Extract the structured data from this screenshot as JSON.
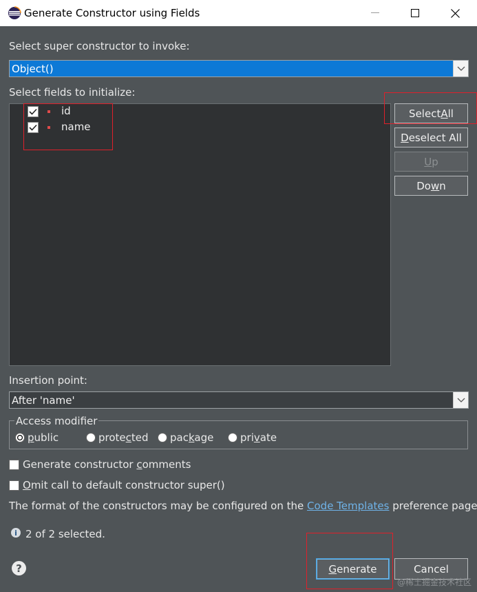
{
  "window": {
    "title": "Generate Constructor using Fields"
  },
  "super_constructor": {
    "label": "Select super constructor to invoke:",
    "selected": "Object()"
  },
  "fields": {
    "label": "Select fields to initialize:",
    "items": [
      {
        "name": "id",
        "checked": true
      },
      {
        "name": "name",
        "checked": true
      }
    ]
  },
  "side_buttons": {
    "select_all_pre": "Select ",
    "select_all_mn": "A",
    "select_all_post": "ll",
    "deselect_all_mn": "D",
    "deselect_all_post": "eselect All",
    "up_mn": "U",
    "up_post": "p",
    "down_pre": "Do",
    "down_mn": "w",
    "down_post": "n"
  },
  "insertion_point": {
    "label": "Insertion point:",
    "selected": "After 'name'"
  },
  "access_modifier": {
    "title": "Access modifier",
    "options": [
      {
        "pre": "",
        "mn": "p",
        "post": "ublic",
        "selected": true
      },
      {
        "pre": "prote",
        "mn": "c",
        "post": "ted",
        "selected": false
      },
      {
        "pre": "pac",
        "mn": "k",
        "post": "age",
        "selected": false
      },
      {
        "pre": "pri",
        "mn": "v",
        "post": "ate",
        "selected": false
      }
    ]
  },
  "options": {
    "generate_comments_pre": "Generate constructor ",
    "generate_comments_mn": "c",
    "generate_comments_post": "omments",
    "omit_super_mn": "O",
    "omit_super_post": "mit call to default constructor super()"
  },
  "info": {
    "text_pre": "The format of the constructors may be configured on the ",
    "link": "Code Templates",
    "text_post": " preference page.",
    "status": "2 of 2 selected."
  },
  "footer": {
    "generate_mn": "G",
    "generate_post": "enerate",
    "cancel": "Cancel"
  },
  "watermark": "@稀土掘金技术社区",
  "icons": {
    "info": "i",
    "help": "?"
  },
  "colors": {
    "highlight": "#e0202a",
    "selection": "#0d79d6",
    "link": "#6fb3e8"
  }
}
